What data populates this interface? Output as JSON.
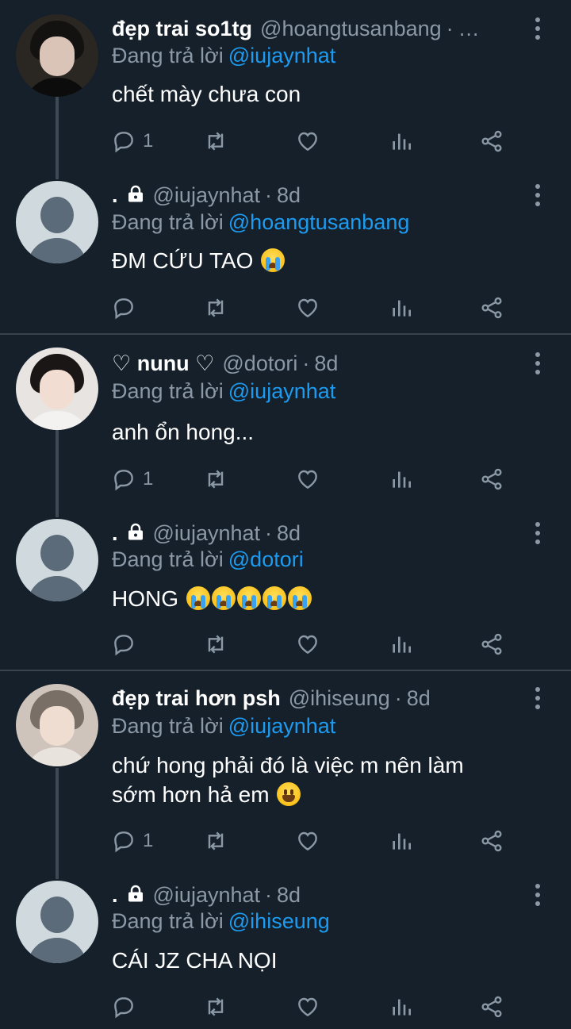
{
  "reply_prefix": "Đang trả lời",
  "threads": [
    {
      "tweet": {
        "name": "đẹp trai so1tg",
        "handle": "@hoangtusanbang",
        "sep": "·",
        "time": "…",
        "reply_to": "@iujaynhat",
        "text": "chết mày chưa con",
        "reply_count": "1"
      },
      "reply": {
        "name": ".",
        "handle": "@iujaynhat",
        "sep": "·",
        "time": "8d",
        "reply_to": "@hoangtusanbang",
        "text": "ĐM CỨU TAO",
        "reply_count": ""
      }
    },
    {
      "tweet": {
        "name": "♡ nunu ♡",
        "handle": "@dotori",
        "sep": "·",
        "time": "8d",
        "reply_to": "@iujaynhat",
        "text": "anh ổn hong...",
        "reply_count": "1"
      },
      "reply": {
        "name": ".",
        "handle": "@iujaynhat",
        "sep": "·",
        "time": "8d",
        "reply_to": "@dotori",
        "text": "HONG",
        "reply_count": ""
      }
    },
    {
      "tweet": {
        "name": "đẹp trai hơn psh",
        "handle": "@ihiseung",
        "sep": "·",
        "time": "8d",
        "reply_to": "@iujaynhat",
        "text_line1": "chứ hong phải đó là việc m nên làm",
        "text_line2": "sớm hơn hả em",
        "reply_count": "1"
      },
      "reply": {
        "name": ".",
        "handle": "@iujaynhat",
        "sep": "·",
        "time": "8d",
        "reply_to": "@ihiseung",
        "text": "CÁI JZ CHA NỌI",
        "reply_count": ""
      }
    }
  ],
  "icons": [
    "reply-icon",
    "retweet-icon",
    "like-icon",
    "analytics-icon",
    "share-icon",
    "lock-icon",
    "more-icon"
  ],
  "colors": {
    "background": "#15202b",
    "mention": "#1d9bf0",
    "muted": "#8b98a5",
    "divider": "#38444d"
  }
}
